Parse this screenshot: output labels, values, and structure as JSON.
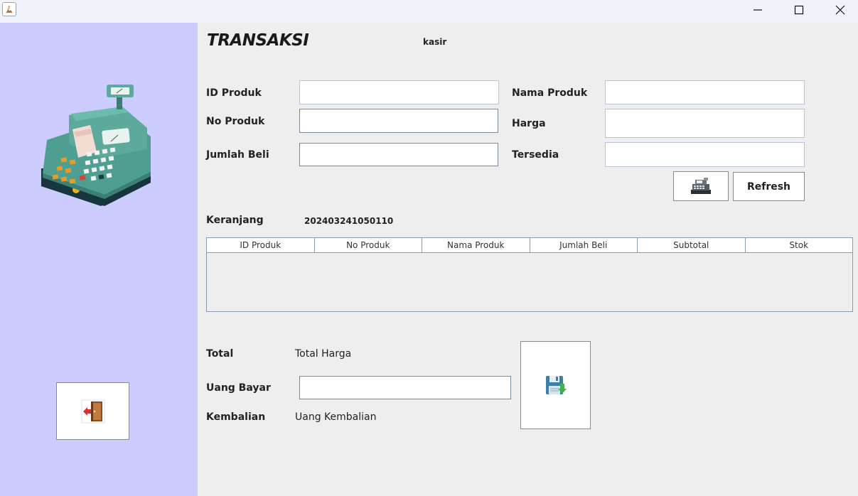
{
  "window": {
    "controls": [
      "minimize",
      "maximize",
      "close"
    ]
  },
  "header": {
    "title": "TRANSAKSI",
    "user": "kasir"
  },
  "form": {
    "id_produk": {
      "label": "ID Produk",
      "value": ""
    },
    "no_produk": {
      "label": "No Produk",
      "value": ""
    },
    "jumlah_beli": {
      "label": "Jumlah Beli",
      "value": ""
    },
    "nama_produk": {
      "label": "Nama Produk",
      "value": ""
    },
    "harga": {
      "label": "Harga",
      "value": ""
    },
    "tersedia": {
      "label": "Tersedia",
      "value": ""
    }
  },
  "buttons": {
    "refresh": "Refresh",
    "add_to_cart_icon": "cash-register-icon",
    "save_icon": "save-icon",
    "exit_icon": "exit-door-icon"
  },
  "cart": {
    "label": "Keranjang",
    "transaction_id": "202403241050110",
    "columns": [
      "ID Produk",
      "No Produk",
      "Nama Produk",
      "Jumlah Beli",
      "Subtotal",
      "Stok"
    ],
    "rows": []
  },
  "summary": {
    "total_label": "Total",
    "total_value": "Total Harga",
    "bayar_label": "Uang Bayar",
    "bayar_value": "",
    "kembalian_label": "Kembalian",
    "kembalian_value": "Uang Kembalian"
  },
  "colors": {
    "sidebar": "#ccccff",
    "background": "#eeeeee",
    "titlebar": "#f0f3f9"
  }
}
